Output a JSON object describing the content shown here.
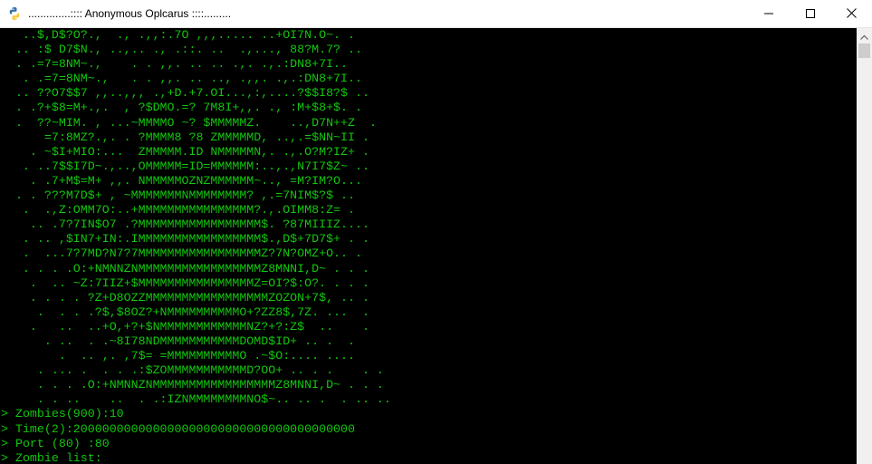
{
  "window": {
    "title": "..............:::: Anonymous Oplcarus ::::.........",
    "minimize_icon": "minimize-icon",
    "maximize_icon": "maximize-icon",
    "close_icon": "close-icon",
    "app_icon": "python-icon"
  },
  "console": {
    "text_color": "#13c70e",
    "background": "#000000",
    "ascii_lines": [
      "   ..$,D$?O?.,  ., .,,:.7O ,,,..... ..+OI7N.O~. .",
      "  .. :$ D7$N., ..,.. ., .::. ..  .,..., 88?M.7? ..",
      "  . .=7=8NM~.,    . . ,,. .. .. .,. .,.:DN8+7I..",
      "   . .=7=8NM~.,   . . ,,. .. .., .,,. .,.:DN8+7I..",
      "  .. ??O7$$7 ,,..,,, .,+D.+7.OI...,:,....?$$I8?$ ..",
      "  . .?+$8=M+.,.  , ?$DMO.=? 7M8I+,,. ., :M+$8+$. .",
      "  .  ??~MIM. , ...~MMMMO ~? $MMMMMZ.    ..,D7N++Z  .",
      "      =7:8MZ?.,. . ?MMMM8 ?8 ZMMMMMD, ..,.=$NN~II .",
      "    . ~$I+MIO:...  ZMMMMM.ID NMMMMMN,. .,.O?M?IZ+ .",
      "   . ..7$$I7D~.,..,OMMMMM=ID=MMMMMM:..,.,N7I7$Z~ ..",
      "    . .7+M$=M+ ,,. NMMMMMOZNZMMMMMM~.., =M?IM?O...",
      "  . . ???M7D$+ , ~MMMMMMMNMMMMMMMM? ,.=7NIM$?$ ..",
      "   .  .,Z:OMM7O:..+MMMMMMMMMMMMMMMM?.,.OIMM8:Z= .",
      "    .. .7?7IN$O7 .?MMMMMMMMMMMMMMMMM$. ?87MIIIZ....",
      "   . .. ,$IN7+IN:.IMMMMMMMMMMMMMMMMM$.,D$+7D7$+ . .",
      "   .  ...7?7MD?N7?7MMMMMMMMMMMMMMMMMZ?7N?OMZ+O.. .",
      "   . . . .O:+NMNNZNMMMMMMMMMMMMMMMMMZ8MNNI,D~ . . .",
      "    .  .. ~Z:7IIZ+$MMMMMMMMMMMMMMMMZ=OI?$:O?. . . .",
      "    . . . . ?Z+D8OZZMMMMMMMMMMMMMMMMMZOZON+7$, .. .",
      "     .  . . .?$,$8OZ?+NMMMMMMMMMMO+?ZZ8$,7Z. ...  .",
      "    .   ..  ..+O,+?+$NMMMMMMMMMMMMNZ?+?:Z$  ..    .",
      "      . ..  . .~8I78NDMMMMMMMMMMMDOMD$ID+ .. .  .",
      "        .  .. ,. ,7$= =MMMMMMMMMMO .~$O:.... ....",
      "     . ... .  . . .:$ZOMMMMMMMMMMMD?OO+ .. . .    . .",
      "     . . . .O:+NMNNZNMMMMMMMMMMMMMMMMMZ8MNNI,D~ . . .",
      "     . . ..    ..  . .:IZNMMMMMMMMNO$~.. .. .  . .. .."
    ],
    "prompt_lines": [
      "> Zombies(900):10",
      "> Time(2):200000000000000000000000000000000000000",
      "> Port (80) :80",
      "> Zombie list:"
    ]
  },
  "scrollbar": {
    "up_icon": "scroll-up-arrow-icon"
  }
}
